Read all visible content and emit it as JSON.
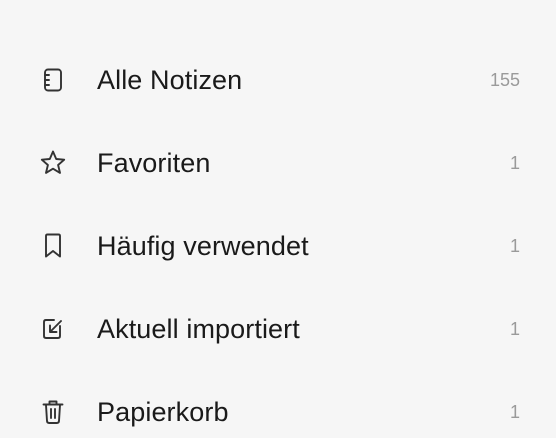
{
  "menu": {
    "items": [
      {
        "label": "Alle Notizen",
        "count": "155",
        "icon": "notebook-icon"
      },
      {
        "label": "Favoriten",
        "count": "1",
        "icon": "star-icon"
      },
      {
        "label": "Häufig verwendet",
        "count": "1",
        "icon": "bookmark-icon"
      },
      {
        "label": "Aktuell importiert",
        "count": "1",
        "icon": "import-icon"
      },
      {
        "label": "Papierkorb",
        "count": "1",
        "icon": "trash-icon"
      }
    ]
  },
  "colors": {
    "background": "#f6f6f6",
    "label": "#1a1a1a",
    "count": "#9a9a9a",
    "icon": "#333333"
  }
}
